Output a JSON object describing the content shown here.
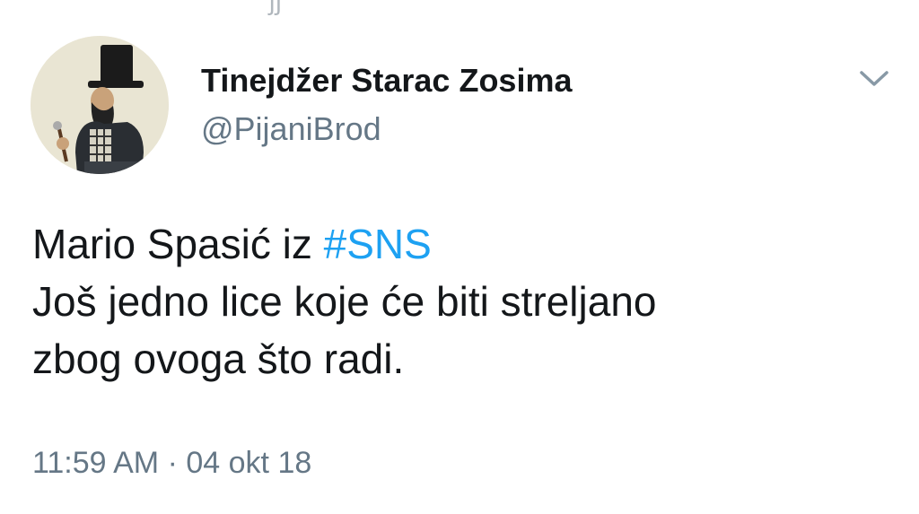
{
  "top_cut_text": "ʃʃ",
  "author": {
    "display_name": "Tinejdžer Starac Zosima",
    "handle": "@PijaniBrod"
  },
  "icons": {
    "menu": "chevron-down-icon"
  },
  "tweet": {
    "line1_text": "Mario Spasić iz ",
    "hashtag": "#SNS",
    "line2": "Još jedno lice koje će biti streljano",
    "line3": "zbog ovoga što radi."
  },
  "meta": {
    "time": "11:59 AM",
    "separator": "·",
    "date": "04 okt 18"
  },
  "colors": {
    "hashtag": "#1da1f2",
    "secondary_text": "#657786",
    "primary_text": "#14171a"
  }
}
